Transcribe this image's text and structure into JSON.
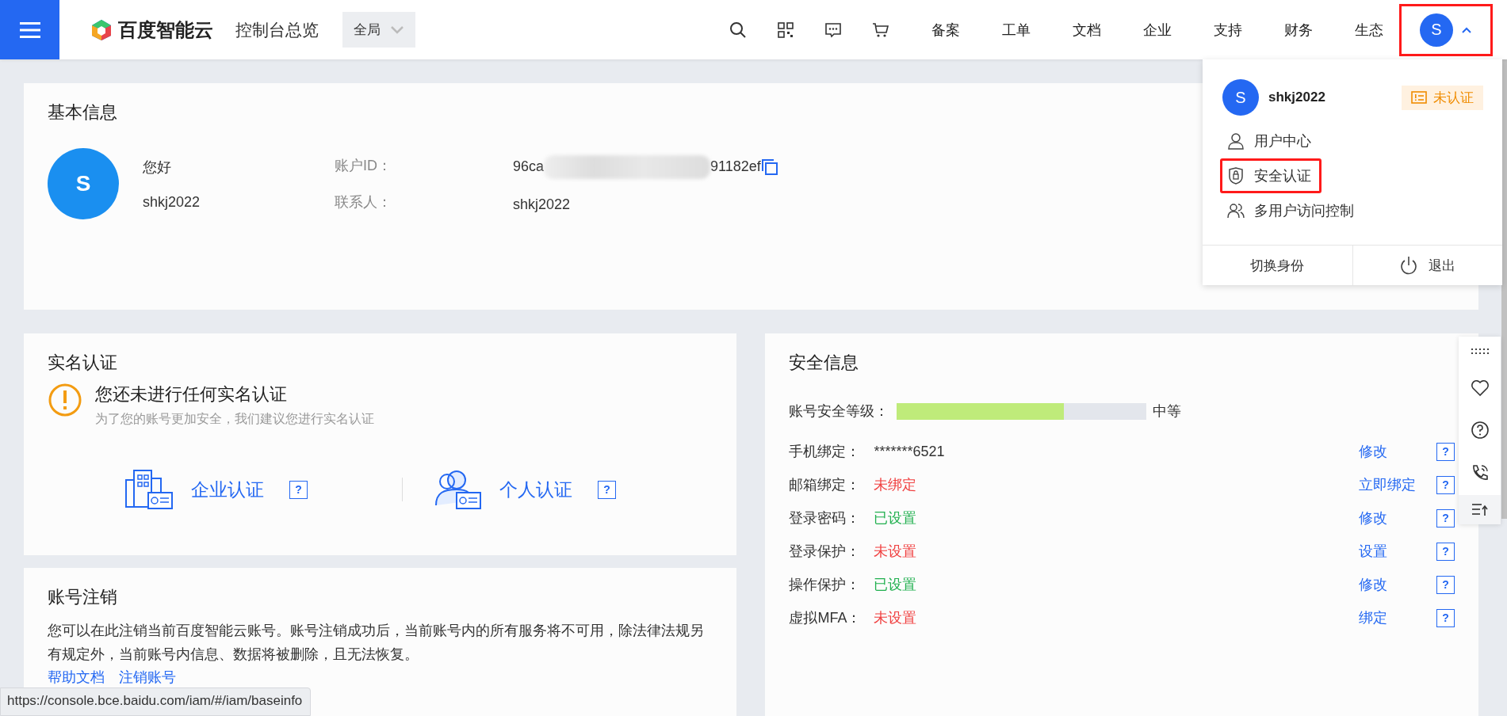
{
  "topbar": {
    "logo": "百度智能云",
    "title": "控制台总览",
    "scope": "全局",
    "nav": [
      "备案",
      "工单",
      "文档",
      "企业",
      "支持",
      "财务",
      "生态"
    ],
    "avatar": "S",
    "highlighted": true
  },
  "user_menu": {
    "avatar": "S",
    "username": "shkj2022",
    "badge": "未认证",
    "items": [
      {
        "label": "用户中心",
        "highlighted": false
      },
      {
        "label": "安全认证",
        "highlighted": true
      },
      {
        "label": "多用户访问控制",
        "highlighted": false
      }
    ],
    "footer": [
      "切换身份",
      "退出"
    ]
  },
  "basic_info": {
    "title": "基本信息",
    "avatar": "S",
    "greeting": "您好",
    "username": "shkj2022",
    "id_label": "账户ID：",
    "id_prefix": "96ca",
    "id_suffix": "91182ef",
    "contact_label": "联系人：",
    "contact": "shkj2022"
  },
  "realname": {
    "title": "实名认证",
    "warning_title": "您还未进行任何实名认证",
    "warning_text": "为了您的账号更加安全，我们建议您进行实名认证",
    "options": [
      {
        "label": "企业认证",
        "help": "?"
      },
      {
        "label": "个人认证",
        "help": "?"
      }
    ]
  },
  "cancel": {
    "title": "账号注销",
    "text": "您可以在此注销当前百度智能云账号。账号注销成功后，当前账号内的所有服务将不可用，除法律法规另有规定外，当前账号内信息、数据将被删除，且无法恢复。",
    "links": [
      "帮助文档",
      "注销账号"
    ]
  },
  "security": {
    "title": "安全信息",
    "level_label": "账号安全等级：",
    "level": 0.667,
    "level_text": "中等",
    "rows": [
      {
        "label": "手机绑定：",
        "value": "*******6521",
        "kind": "plain",
        "action": "修改",
        "help": "?"
      },
      {
        "label": "邮箱绑定：",
        "value": "未绑定",
        "kind": "negative",
        "action": "立即绑定",
        "help": "?"
      },
      {
        "label": "登录密码：",
        "value": "已设置",
        "kind": "positive",
        "action": "修改",
        "help": "?"
      },
      {
        "label": "登录保护：",
        "value": "未设置",
        "kind": "negative",
        "action": "设置",
        "help": "?"
      },
      {
        "label": "操作保护：",
        "value": "已设置",
        "kind": "positive",
        "action": "修改",
        "help": "?"
      },
      {
        "label": "虚拟MFA：",
        "value": "未设置",
        "kind": "negative",
        "action": "绑定",
        "help": "?"
      }
    ]
  },
  "status_url": "https://console.bce.baidu.com/iam/#/iam/baseinfo"
}
